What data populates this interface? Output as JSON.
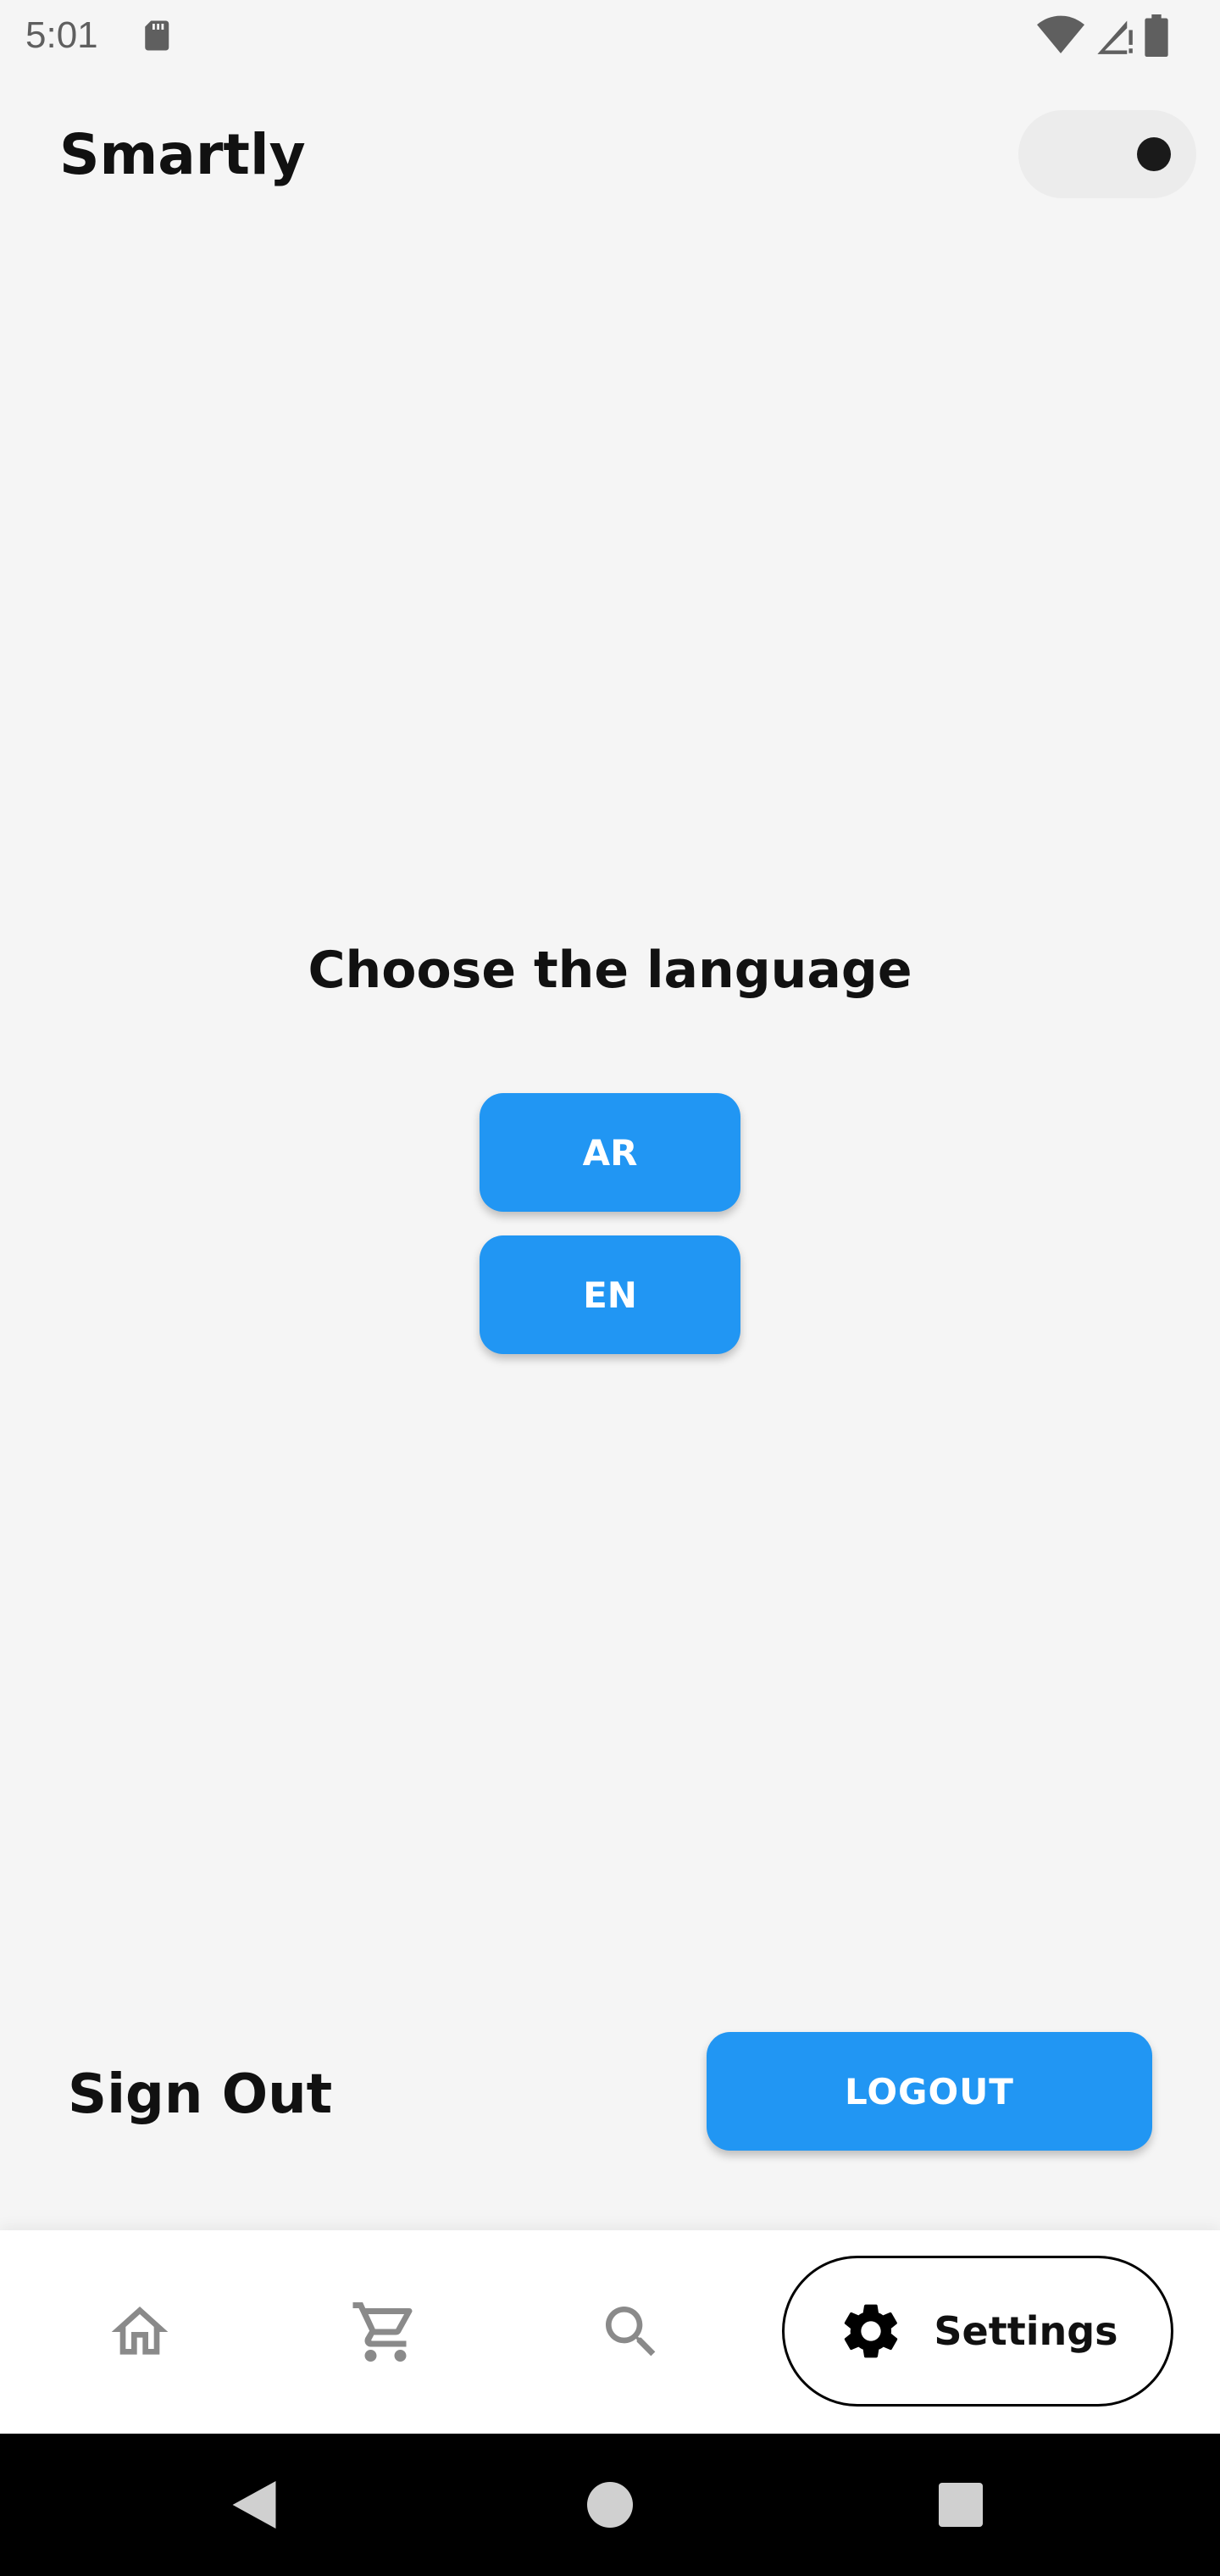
{
  "status_bar": {
    "time": "5:01",
    "icons": [
      "sd-card-icon",
      "wifi-icon",
      "signal-icon",
      "battery-icon"
    ]
  },
  "app_bar": {
    "title": "Smartly",
    "theme_toggle": {
      "icon": "toggle-switch"
    }
  },
  "language": {
    "title": "Choose the language",
    "options": [
      {
        "label": "AR"
      },
      {
        "label": "EN"
      }
    ]
  },
  "sign_out": {
    "label": "Sign Out",
    "button_label": "LOGOUT"
  },
  "bottom_nav": {
    "items": [
      {
        "icon": "home-icon"
      },
      {
        "icon": "cart-icon"
      },
      {
        "icon": "search-icon"
      },
      {
        "icon": "gear-icon",
        "label": "Settings"
      }
    ]
  },
  "colors": {
    "primary": "#2196f3",
    "background": "#f5f5f5",
    "nav_background": "#ffffff",
    "system_nav": "#000000",
    "inactive_icon": "#8a8a8a"
  }
}
